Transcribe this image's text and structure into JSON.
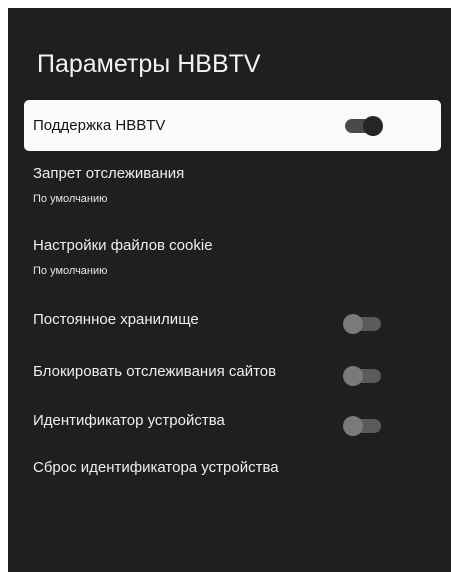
{
  "screen": {
    "title": "Параметры HBBTV"
  },
  "items": [
    {
      "label": "Поддержка HBBTV",
      "toggle": "on",
      "focused": true
    },
    {
      "label": "Запрет отслеживания",
      "value": "По умолчанию"
    },
    {
      "label": "Настройки файлов cookie",
      "value": "По умолчанию"
    },
    {
      "label": "Постоянное хранилище",
      "toggle": "off"
    },
    {
      "label": "Блокировать отслеживания сайтов",
      "toggle": "off"
    },
    {
      "label": "Идентификатор устройства",
      "toggle": "off"
    },
    {
      "label": "Сброс идентификатора устройства"
    }
  ],
  "colors": {
    "background": "#1f1f1f",
    "focus_highlight": "#fafafa",
    "text": "#eeeeee"
  },
  "icons": [
    "toggle-switch-icon"
  ]
}
